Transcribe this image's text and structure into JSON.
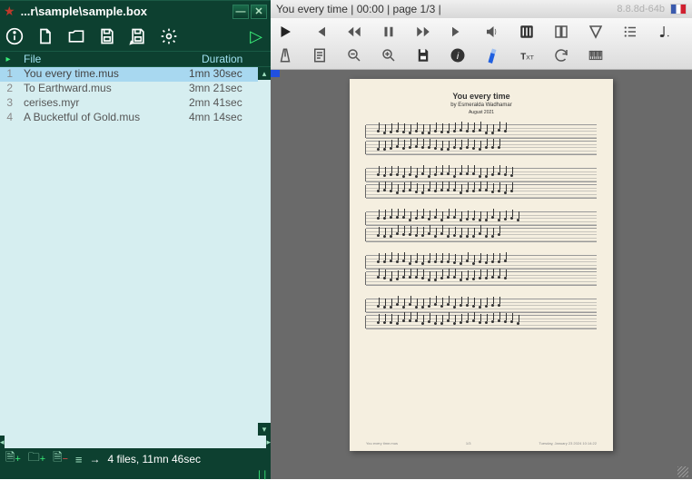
{
  "titlebar": {
    "path": "...r\\sample\\sample.box"
  },
  "columns": {
    "file": "File",
    "duration": "Duration"
  },
  "files": [
    {
      "n": "1",
      "name": "You every time.mus",
      "dur": "1mn 30sec"
    },
    {
      "n": "2",
      "name": "To Earthward.mus",
      "dur": "3mn 21sec"
    },
    {
      "n": "3",
      "name": "cerises.myr",
      "dur": "2mn 41sec"
    },
    {
      "n": "4",
      "name": "A Bucketful of Gold.mus",
      "dur": "4mn 14sec"
    }
  ],
  "status": {
    "summary": "4 files, 11mn 46sec"
  },
  "preview": {
    "title_line": "You every time | 00:00 | page 1/3 |",
    "version": "8.8.8d-64b"
  },
  "score": {
    "title": "You every time",
    "subtitle": "by Esmeralda Wadhamar",
    "date": "August 2021",
    "footer_left": "You every time.mus",
    "footer_center": "1/3",
    "footer_right": "Tuesday, January 23 2024 10:14:22"
  }
}
